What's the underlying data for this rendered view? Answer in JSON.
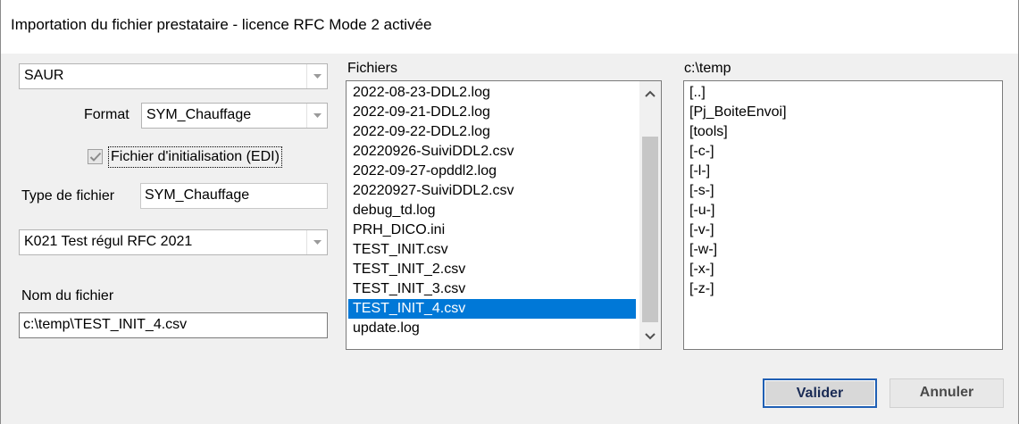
{
  "window": {
    "title": "Importation du fichier prestataire - licence RFC Mode 2 activée"
  },
  "left": {
    "provider_combo": "SAUR",
    "format_label": "Format",
    "format_combo": "SYM_Chauffage",
    "init_checkbox": {
      "label": "Fichier d'initialisation (EDI)",
      "checked": true
    },
    "file_type_label": "Type de fichier",
    "file_type_value": "SYM_Chauffage",
    "test_combo": "K021  Test régul RFC 2021",
    "file_name_label": "Nom du fichier",
    "file_name_value": "c:\\temp\\TEST_INIT_4.csv"
  },
  "files": {
    "label": "Fichiers",
    "items": [
      "2022-08-23-DDL2.log",
      "2022-09-21-DDL2.log",
      "2022-09-22-DDL2.log",
      "20220926-SuiviDDL2.csv",
      "2022-09-27-opddl2.log",
      "20220927-SuiviDDL2.csv",
      "debug_td.log",
      "PRH_DICO.ini",
      "TEST_INIT.csv",
      "TEST_INIT_2.csv",
      "TEST_INIT_3.csv",
      "TEST_INIT_4.csv",
      "update.log"
    ],
    "selected_index": 11
  },
  "dirs": {
    "label": "c:\\temp",
    "items": [
      "[..]",
      "[Pj_BoiteEnvoi]",
      "[tools]",
      "[-c-]",
      "[-l-]",
      "[-s-]",
      "[-u-]",
      "[-v-]",
      "[-w-]",
      "[-x-]",
      "[-z-]"
    ]
  },
  "buttons": {
    "ok": "Valider",
    "cancel": "Annuler"
  },
  "colors": {
    "selection": "#0078d7",
    "primary_border": "#1f5fb4"
  },
  "icons": {
    "combo_arrow": "chevron-down-icon",
    "scroll_up": "chevron-up-icon",
    "scroll_down": "chevron-down-icon",
    "checkbox": "checkmark-icon"
  }
}
